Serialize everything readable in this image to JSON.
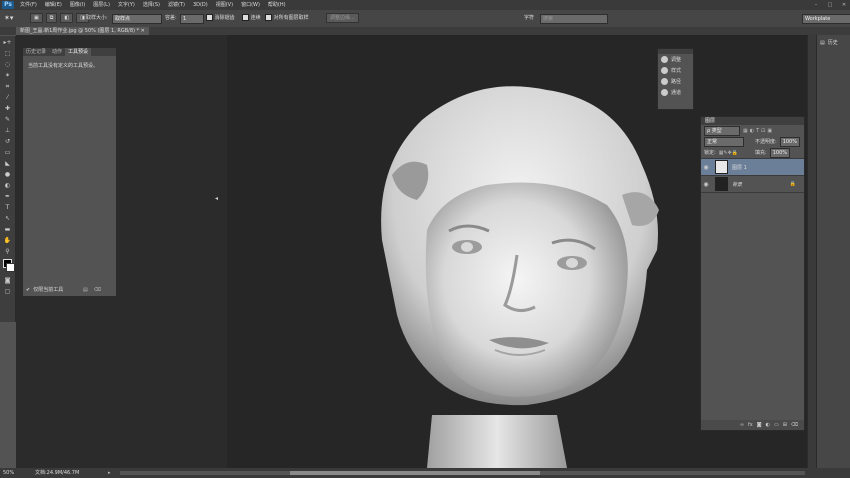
{
  "app": {
    "logo": "Ps"
  },
  "menu": [
    "文件(F)",
    "编辑(E)",
    "图像(I)",
    "图层(L)",
    "文字(Y)",
    "选择(S)",
    "滤镜(T)",
    "3D(D)",
    "视图(V)",
    "窗口(W)",
    "帮助(H)"
  ],
  "options": {
    "brush_size_label": "取样大小:",
    "brush_size_value": "取样点",
    "tolerance_label": "容差:",
    "tolerance_value": "1",
    "antialias_label": "消除锯齿",
    "contiguous_label": "连续",
    "sample_all_label": "对所有图层取样",
    "refine_button": "调整边缘...",
    "workspace_label": "字符",
    "workspace_search": "搜索",
    "workspace_select": "Workplate"
  },
  "document": {
    "tab_label": "新图_王晶.新1周作业.jpg @ 50% (图层 1, RGB/8) *"
  },
  "history_panel": {
    "tabs": [
      "历史记录",
      "动作",
      "工具预设"
    ],
    "active_tab": "工具预设",
    "empty_message": "当前工具没有定义的工具预设。",
    "footer_label": "仅限当前工具"
  },
  "adjust_panel": {
    "items": [
      {
        "icon": "adjustments-icon",
        "label": "调整"
      },
      {
        "icon": "styles-icon",
        "label": "样式"
      },
      {
        "icon": "paths-icon",
        "label": "路径"
      },
      {
        "icon": "channels-icon",
        "label": "通道"
      }
    ]
  },
  "layers_panel": {
    "title": "图层",
    "kind_label": "ρ 类型",
    "blend_mode": "正常",
    "opacity_label": "不透明度:",
    "opacity_value": "100%",
    "lock_label": "锁定:",
    "fill_label": "填充:",
    "fill_value": "100%",
    "layers": [
      {
        "name": "图层 1",
        "selected": true,
        "locked": false
      },
      {
        "name": "背景",
        "selected": false,
        "locked": true
      }
    ]
  },
  "right_strip": {
    "history_label": "历史"
  },
  "status": {
    "zoom": "50%",
    "doc_info": "文档:24.9M/46.7M"
  },
  "colors": {
    "ui_dark": "#535353",
    "canvas_bg": "#262626",
    "selected_layer": "#6b7f99"
  }
}
